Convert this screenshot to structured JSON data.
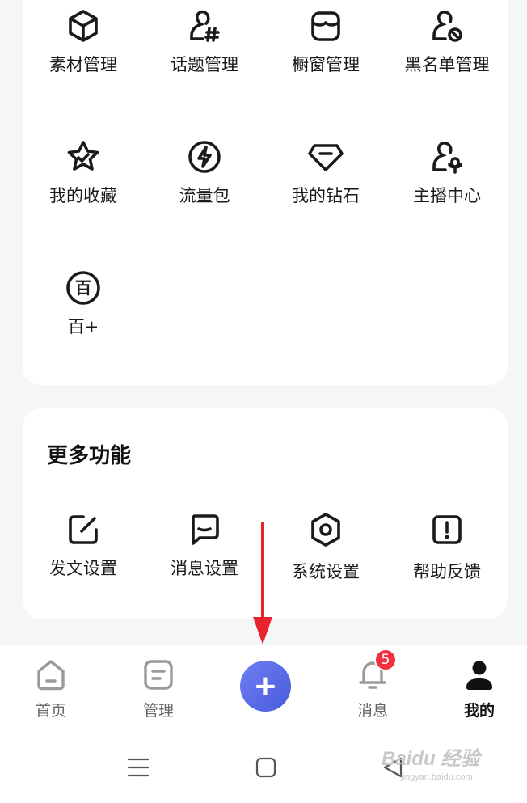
{
  "tools": [
    {
      "label": "素材管理",
      "icon": "cube-icon"
    },
    {
      "label": "话题管理",
      "icon": "user-hashtag-icon"
    },
    {
      "label": "橱窗管理",
      "icon": "storefront-icon"
    },
    {
      "label": "黑名单管理",
      "icon": "user-blocked-icon"
    },
    {
      "label": "我的收藏",
      "icon": "star-check-icon"
    },
    {
      "label": "流量包",
      "icon": "lightning-icon"
    },
    {
      "label": "我的钻石",
      "icon": "diamond-icon"
    },
    {
      "label": "主播中心",
      "icon": "user-mic-icon"
    },
    {
      "label": "百+",
      "icon": "bai-badge-icon",
      "glyph": "百"
    }
  ],
  "more": {
    "title": "更多功能",
    "items": [
      {
        "label": "发文设置",
        "icon": "edit-icon"
      },
      {
        "label": "消息设置",
        "icon": "message-icon"
      },
      {
        "label": "系统设置",
        "icon": "settings-hex-icon"
      },
      {
        "label": "帮助反馈",
        "icon": "alert-square-icon"
      }
    ]
  },
  "tabbar": {
    "tabs": [
      {
        "label": "首页",
        "icon": "home-icon"
      },
      {
        "label": "管理",
        "icon": "manage-icon"
      },
      {
        "label": "消息",
        "icon": "bell-icon",
        "badge": "5"
      },
      {
        "label": "我的",
        "icon": "profile-icon",
        "active": true
      }
    ],
    "plus": "+"
  },
  "watermark": {
    "main": "Baidu 经验",
    "sub": "jingyan.baidu.com"
  },
  "colors": {
    "accent": "#5565e6",
    "badge": "#f2313f",
    "annotation": "#e8232b"
  }
}
